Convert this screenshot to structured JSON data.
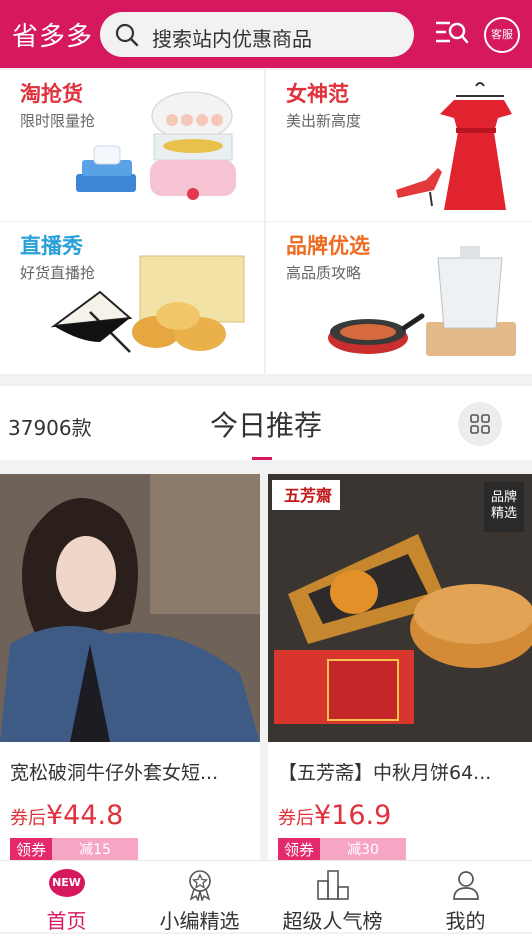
{
  "header": {
    "logo": "省多多",
    "search_placeholder": "搜索站内优惠商品",
    "service_label": "客服"
  },
  "categories": [
    {
      "title": "淘抢货",
      "subtitle": "限时限量抢"
    },
    {
      "title": "女神范",
      "subtitle": "美出新高度"
    },
    {
      "title": "直播秀",
      "subtitle": "好货直播抢"
    },
    {
      "title": "品牌优选",
      "subtitle": "高品质攻略"
    }
  ],
  "recommend": {
    "count": "37906款",
    "title": "今日推荐"
  },
  "products": [
    {
      "name": "宽松破洞牛仔外套女短...",
      "price_label": "券后",
      "price": "¥44.8",
      "coupon_label": "领券",
      "coupon_value": "减15"
    },
    {
      "name": "【五芳斋】中秋月饼64...",
      "price_label": "券后",
      "price": "¥16.9",
      "coupon_label": "领券",
      "coupon_value": "减30",
      "badge": "品牌精选",
      "brand_logo": "五芳齋"
    }
  ],
  "tabbar": {
    "tabs": [
      {
        "label": "首页",
        "badge": "NEW"
      },
      {
        "label": "小编精选"
      },
      {
        "label": "超级人气榜"
      },
      {
        "label": "我的"
      }
    ]
  },
  "colors": {
    "brand": "#d6185e",
    "price": "#e0323c"
  }
}
